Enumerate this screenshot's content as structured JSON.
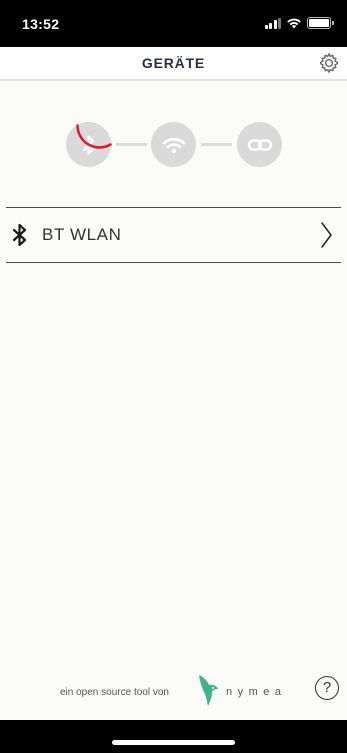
{
  "status_bar": {
    "time": "13:52",
    "signal_icon": "cellular-signal-icon",
    "wifi_icon": "wifi-icon",
    "battery_icon": "battery-icon"
  },
  "header": {
    "title": "GERÄTE",
    "settings_icon": "gear-icon"
  },
  "steps": [
    {
      "icon": "bluetooth-icon",
      "state": "active"
    },
    {
      "icon": "wifi-icon",
      "state": "pending"
    },
    {
      "icon": "link-icon",
      "state": "pending"
    }
  ],
  "devices": [
    {
      "icon": "bluetooth-icon",
      "name": "BT WLAN"
    }
  ],
  "footer": {
    "text": "ein open source tool von",
    "brand": "nymea",
    "help_label": "?"
  },
  "colors": {
    "accent": "#e0192b",
    "step_bg": "#dadada",
    "title": "#2b2d42",
    "logo": "#3fb28f"
  }
}
